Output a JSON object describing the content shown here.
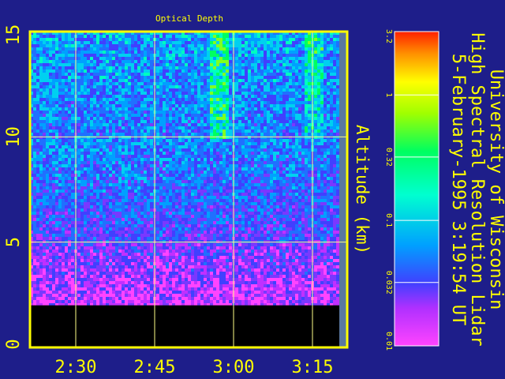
{
  "chart_data": {
    "type": "heatmap",
    "title": "Optical Depth",
    "ylabel": "Altitude (km)",
    "xlabel": "",
    "yticks": [
      "0",
      "5",
      "10",
      "15"
    ],
    "ylim": [
      0,
      15
    ],
    "xticks": [
      "2:30",
      "2:45",
      "3:00",
      "3:15"
    ],
    "grid": true,
    "colorbar": {
      "ticks": [
        "3.2",
        "1",
        "0.32",
        "0.1",
        "0.032",
        "0.01"
      ],
      "scale": "log",
      "range": [
        0.01,
        3.2
      ]
    },
    "no_data_below_km": 2
  },
  "side_text": {
    "line1": "University of Wisconsin",
    "line2": "High Spectral Resolution Lidar",
    "line3": "5-February-1995   3:19:54 UT"
  },
  "colors": {
    "background": "#1e1e8a",
    "frame": "#ffff00",
    "grid": "#ffff88",
    "text": "#ffff00",
    "no_data": "#000000"
  }
}
